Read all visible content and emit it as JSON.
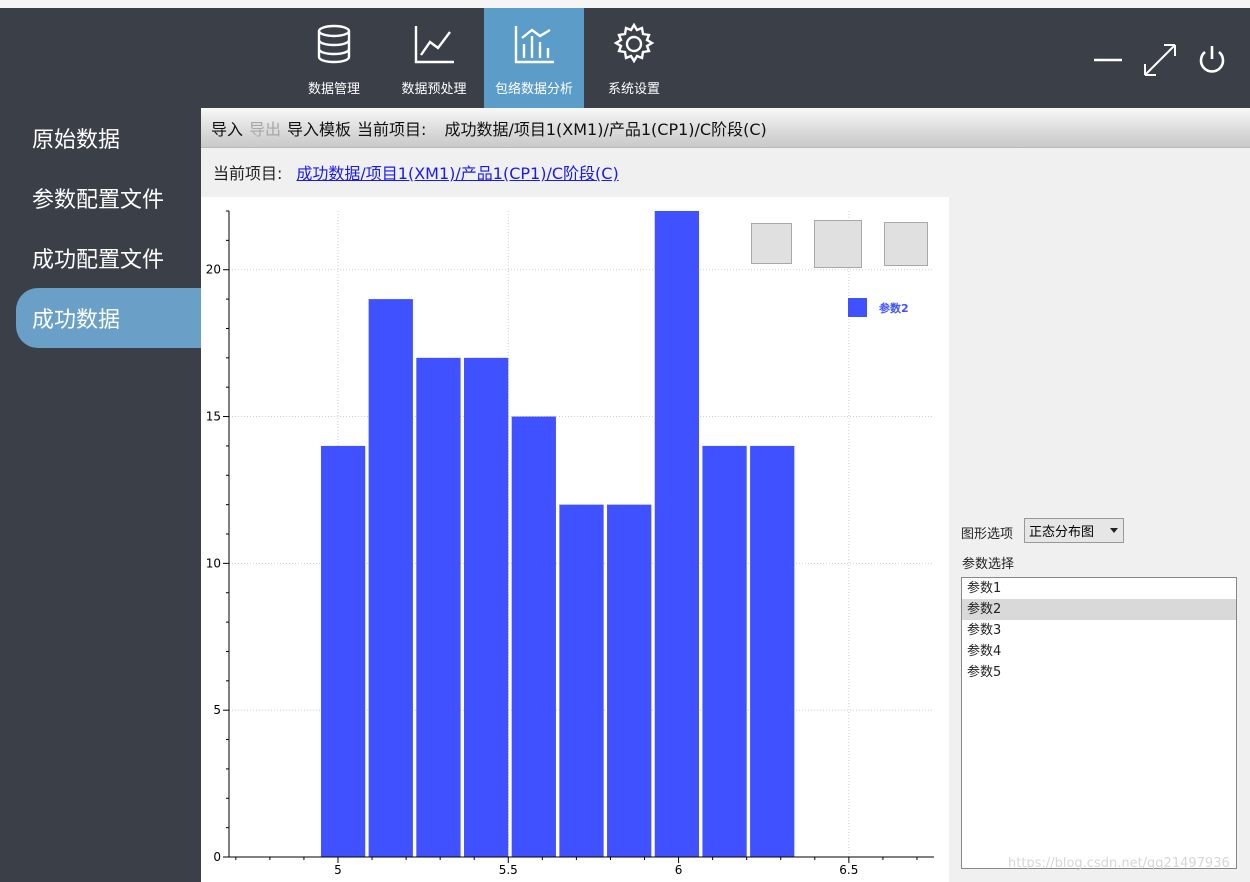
{
  "nav": {
    "items": [
      {
        "label": "数据管理",
        "icon": "database-icon"
      },
      {
        "label": "数据预处理",
        "icon": "line-chart-icon"
      },
      {
        "label": "包络数据分析",
        "icon": "bar-chart-icon"
      },
      {
        "label": "系统设置",
        "icon": "gear-icon"
      }
    ],
    "active_index": 2
  },
  "sidebar": {
    "items": [
      {
        "label": "原始数据"
      },
      {
        "label": "参数配置文件"
      },
      {
        "label": "成功配置文件"
      },
      {
        "label": "成功数据"
      }
    ],
    "active_index": 3
  },
  "toolbar": {
    "import": "导入",
    "export": "导出",
    "import_template": "导入模板",
    "current_project_label": "当前项目:",
    "current_project_value": "成功数据/项目1(XM1)/产品1(CP1)/C阶段(C)"
  },
  "project_line": {
    "label": "当前项目:",
    "link": "成功数据/项目1(XM1)/产品1(CP1)/C阶段(C)"
  },
  "chart_data": {
    "type": "bar",
    "series": [
      {
        "name": "参数2",
        "color": "#4052ff",
        "bins": [
          {
            "x0": 4.95,
            "x1": 5.08,
            "value": 14
          },
          {
            "x0": 5.09,
            "x1": 5.22,
            "value": 19
          },
          {
            "x0": 5.23,
            "x1": 5.36,
            "value": 17
          },
          {
            "x0": 5.37,
            "x1": 5.5,
            "value": 17
          },
          {
            "x0": 5.51,
            "x1": 5.64,
            "value": 15
          },
          {
            "x0": 5.65,
            "x1": 5.78,
            "value": 12
          },
          {
            "x0": 5.79,
            "x1": 5.92,
            "value": 12
          },
          {
            "x0": 5.93,
            "x1": 6.06,
            "value": 22
          },
          {
            "x0": 6.07,
            "x1": 6.2,
            "value": 14
          },
          {
            "x0": 6.21,
            "x1": 6.34,
            "value": 14
          }
        ]
      }
    ],
    "xlim": [
      4.68,
      6.75
    ],
    "ylim": [
      0,
      22
    ],
    "xticks": [
      5,
      5.5,
      6,
      6.5
    ],
    "xtick_labels": [
      "5",
      "5.5",
      "6",
      "6.5"
    ],
    "yticks": [
      0,
      5,
      10,
      15,
      20
    ],
    "ytick_labels": [
      "0",
      "5",
      "10",
      "15",
      "20"
    ],
    "grid": true,
    "legend_position": "top-right",
    "title": "",
    "xlabel": "",
    "ylabel": ""
  },
  "right_panel": {
    "chart_option_label": "图形选项",
    "chart_option_value": "正态分布图",
    "param_select_label": "参数选择",
    "params": [
      "参数1",
      "参数2",
      "参数3",
      "参数4",
      "参数5"
    ],
    "selected_index": 1
  },
  "watermark": "https://blog.csdn.net/qq21497936"
}
